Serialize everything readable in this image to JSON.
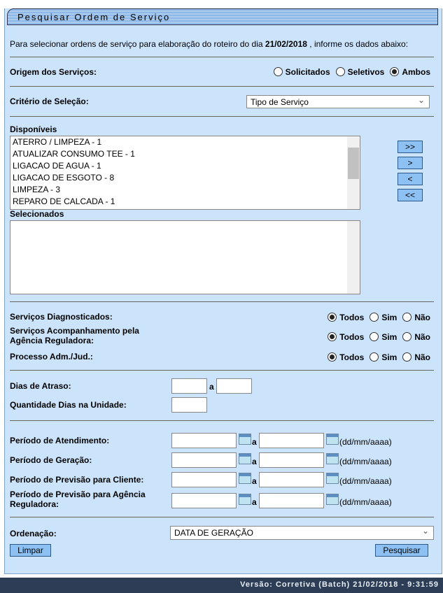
{
  "title": "Pesquisar Ordem de Serviço",
  "intro_pre": "Para selecionar ordens de serviço para elaboração do roteiro do dia ",
  "intro_date": "21/02/2018",
  "intro_post": " , informe os dados abaixo:",
  "origem": {
    "label": "Origem dos Serviços:",
    "options": [
      "Solicitados",
      "Seletivos",
      "Ambos"
    ],
    "selected": "Ambos"
  },
  "criterio": {
    "label": "Critério de Seleção:",
    "value": "Tipo de Serviço"
  },
  "disponiveis": {
    "label": "Disponíveis",
    "items": [
      "ATERRO / LIMPEZA - 1",
      "ATUALIZAR CONSUMO TEE - 1",
      "LIGACAO DE AGUA - 1",
      "LIGACAO DE ESGOTO - 8",
      "LIMPEZA - 3",
      "REPARO DE CALCADA - 1"
    ]
  },
  "selecionados": {
    "label": "Selecionados",
    "items": []
  },
  "move_buttons": [
    ">>",
    ">",
    "<",
    "<<"
  ],
  "radios": [
    {
      "label": "Serviços Diagnosticados:",
      "options": [
        "Todos",
        "Sim",
        "Não"
      ],
      "selected": "Todos"
    },
    {
      "label": "Serviços Acompanhamento pela Agência Reguladora:",
      "options": [
        "Todos",
        "Sim",
        "Não"
      ],
      "selected": "Todos"
    },
    {
      "label": "Processo Adm./Jud.:",
      "options": [
        "Todos",
        "Sim",
        "Não"
      ],
      "selected": "Todos"
    }
  ],
  "dias_atraso": {
    "label": "Dias de Atraso:",
    "sep": "a"
  },
  "qtd_dias": {
    "label": "Quantidade Dias na Unidade:"
  },
  "periodos": [
    {
      "label": "Período de Atendimento:"
    },
    {
      "label": "Período de Geração:"
    },
    {
      "label": "Período de Previsão para Cliente:"
    },
    {
      "label": "Período de Previsão para Agência Reguladora:"
    }
  ],
  "periodo_sep": "a",
  "date_format": "(dd/mm/aaaa)",
  "ordenacao": {
    "label": "Ordenação:",
    "value": "DATA DE GERAÇÃO"
  },
  "limpar": "Limpar",
  "pesquisar": "Pesquisar",
  "footer": "Versão: Corretiva (Batch) 21/02/2018 - 9:31:59"
}
